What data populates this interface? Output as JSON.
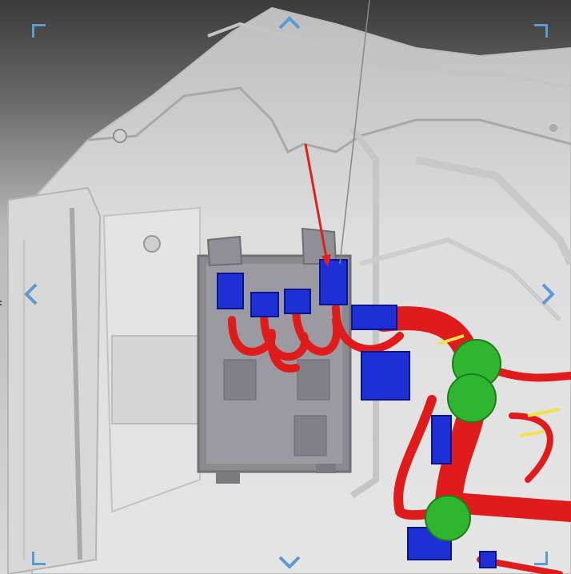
{
  "viewer": {
    "title": "",
    "accent_color": "#5b9bd5",
    "highlight_color": "#e02020",
    "nav": {
      "up_icon": "chevron-up-icon",
      "down_icon": "chevron-down-icon",
      "left_icon": "chevron-left-icon",
      "right_icon": "chevron-right-icon"
    },
    "parts": {
      "module": "fuse-box-module",
      "connectors": "blue-connectors",
      "harness": "red-wire-harness",
      "grommets": "green-grommets",
      "callout": "red-pointer-arrow"
    }
  }
}
